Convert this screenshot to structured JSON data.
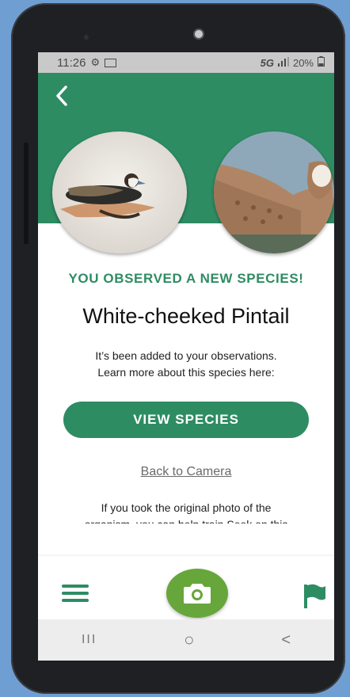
{
  "status": {
    "time": "11:26",
    "network": "5G",
    "battery": "20%"
  },
  "header": {
    "back_icon": "chevron-left-icon"
  },
  "observation": {
    "headline": "YOU OBSERVED A NEW SPECIES!",
    "species_name": "White-cheeked Pintail",
    "description_line1": "It’s been added to your observations.",
    "description_line2": "Learn more about this species here:",
    "view_button": "VIEW SPECIES",
    "back_link": "Back to Camera",
    "info_line1": "If you took the original photo of the",
    "info_line2": "organism, you can help train Seek on this"
  },
  "bottom_nav": {
    "menu_icon": "menu-icon",
    "camera_icon": "camera-icon",
    "flag_icon": "flag-icon"
  },
  "system_nav": {
    "recents": "III",
    "home": "○",
    "back": "<"
  },
  "colors": {
    "accent": "#2e8c63",
    "camera_button": "#67a63b"
  }
}
